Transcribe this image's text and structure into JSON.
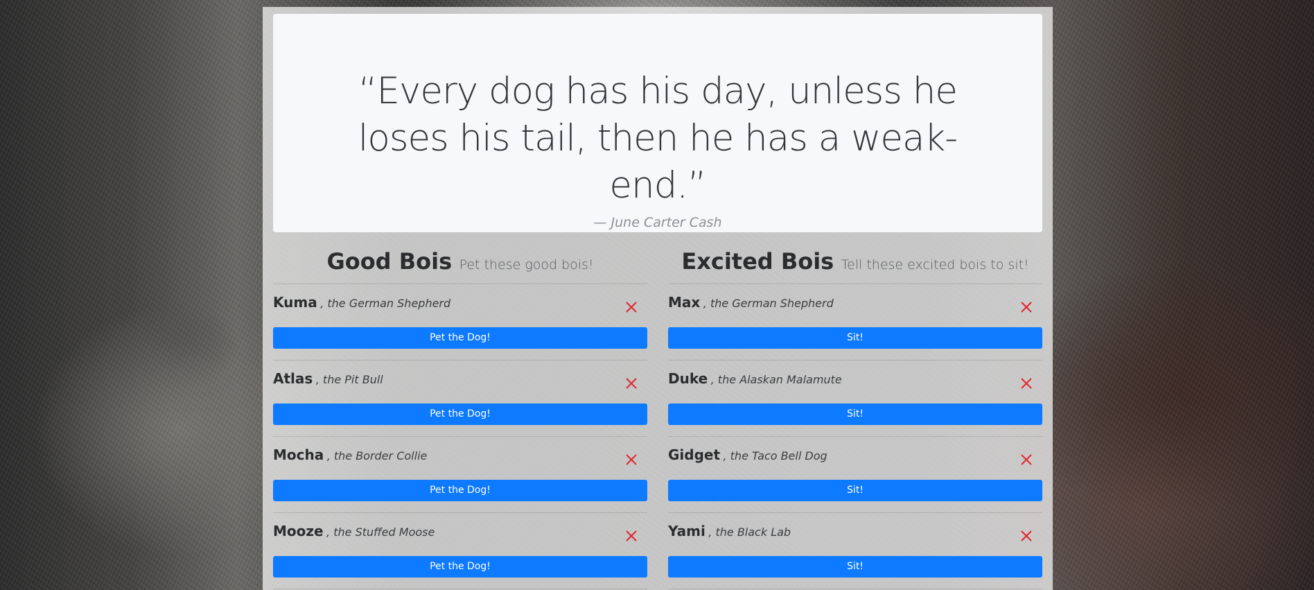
{
  "quote": {
    "text": "“Every dog has his day, unless he loses his tail, then he has a weak-end.”",
    "author": "— June Carter Cash"
  },
  "good_bois": {
    "title": "Good Bois",
    "subtitle": "Pet these good bois!",
    "button_label": "Pet the Dog!",
    "dogs": [
      {
        "name": "Kuma",
        "breed": ", the German Shepherd"
      },
      {
        "name": "Atlas",
        "breed": ", the Pit Bull"
      },
      {
        "name": "Mocha",
        "breed": ", the Border Collie"
      },
      {
        "name": "Mooze",
        "breed": ", the Stuffed Moose"
      }
    ]
  },
  "excited_bois": {
    "title": "Excited Bois",
    "subtitle": "Tell these excited bois to sit!",
    "button_label": "Sit!",
    "dogs": [
      {
        "name": "Max",
        "breed": ", the German Shepherd"
      },
      {
        "name": "Duke",
        "breed": ", the Alaskan Malamute"
      },
      {
        "name": "Gidget",
        "breed": ", the Taco Bell Dog"
      },
      {
        "name": "Yami",
        "breed": ", the Black Lab"
      }
    ]
  },
  "colors": {
    "button": "#0d7aff",
    "remove_icon": "#e0262f"
  },
  "icons": {
    "remove": "close-icon"
  }
}
